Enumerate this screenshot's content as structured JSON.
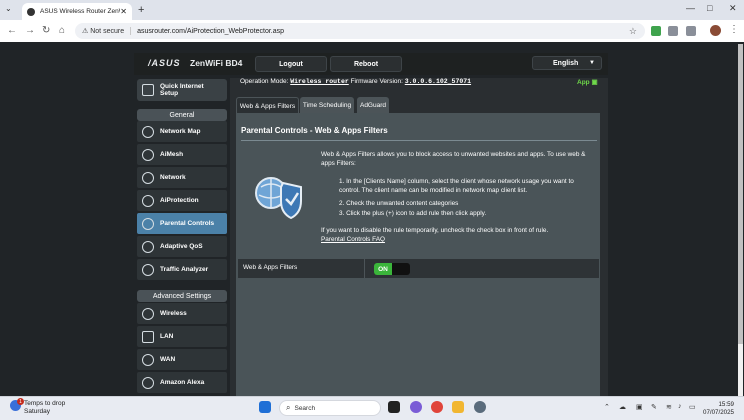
{
  "browser": {
    "tab_title": "ASUS Wireless Router ZenWiFi",
    "new_tab": "+",
    "not_secure": "Not secure",
    "url": "asusrouter.com/AiProtection_WebProtector.asp",
    "window_controls": [
      "—",
      "□",
      "✕"
    ]
  },
  "header": {
    "brand": "/ASUS",
    "model": "ZenWiFi BD4",
    "logout": "Logout",
    "reboot": "Reboot",
    "language": "English"
  },
  "status": {
    "op_mode_label": "Operation Mode:",
    "op_mode_value": "Wireless router",
    "fw_label": "Firmware Version:",
    "fw_value": "3.0.0.6.102_57071",
    "app_label": "App"
  },
  "sidebar": {
    "quick_setup": "Quick Internet Setup",
    "general_header": "General",
    "general_items": [
      {
        "label": "Network Map"
      },
      {
        "label": "AiMesh"
      },
      {
        "label": "Network"
      },
      {
        "label": "AiProtection"
      },
      {
        "label": "Parental Controls"
      },
      {
        "label": "Adaptive QoS"
      },
      {
        "label": "Traffic Analyzer"
      }
    ],
    "advanced_header": "Advanced Settings",
    "advanced_items": [
      {
        "label": "Wireless"
      },
      {
        "label": "LAN"
      },
      {
        "label": "WAN"
      },
      {
        "label": "Amazon Alexa"
      }
    ]
  },
  "tabs": [
    "Web & Apps Filters",
    "Time Scheduling",
    "AdGuard"
  ],
  "content": {
    "title": "Parental Controls - Web & Apps Filters",
    "intro": "Web & Apps Filters allows you to block access to unwanted websites and apps. To use web & apps Filters:",
    "steps": [
      "1. In the [Clients Name] column, select the client whose network usage you want to control. The client name can be modified in network map client list.",
      "2. Check the unwanted content categories",
      "3. Click the plus (+) icon to add rule then click apply."
    ],
    "disable_note": "If you want to disable the rule temporarily, uncheck the check box in front of rule.",
    "faq_link": "Parental Controls FAQ",
    "filter_label": "Web & Apps Filters",
    "toggle_state": "ON"
  },
  "taskbar": {
    "weather_line1": "Temps to drop",
    "weather_line2": "Saturday",
    "weather_badge": "1",
    "search_placeholder": "Search",
    "time": "15:59",
    "date": "07/07/2025"
  },
  "colors": {
    "accent_active": "#4b81a8",
    "toggle_on": "#3bb53b",
    "app_green": "#6fd94a"
  }
}
